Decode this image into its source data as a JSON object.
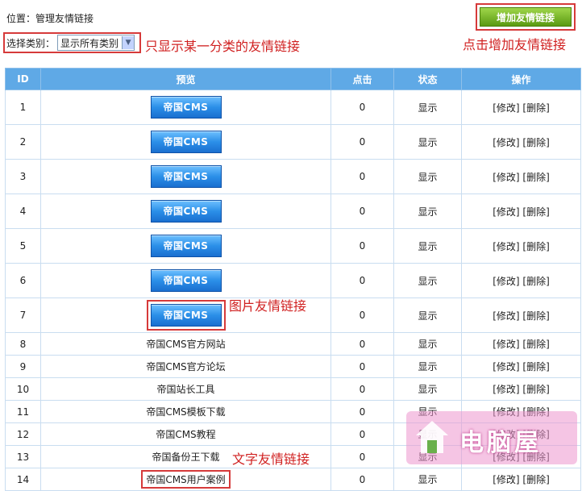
{
  "location": "位置：管理友情链接",
  "add_button": "增加友情链接",
  "notes": {
    "filter": "只显示某一分类的友情链接",
    "add": "点击增加友情链接",
    "image_link": "图片友情链接",
    "text_link": "文字友情链接"
  },
  "filter": {
    "label": "选择类别：",
    "selected": "显示所有类别"
  },
  "table": {
    "headers": [
      "ID",
      "预览",
      "点击",
      "状态",
      "操作"
    ],
    "rows": [
      {
        "id": "1",
        "preview": "帝国CMS",
        "type": "image",
        "clicks": "0",
        "status": "显示"
      },
      {
        "id": "2",
        "preview": "帝国CMS",
        "type": "image",
        "clicks": "0",
        "status": "显示"
      },
      {
        "id": "3",
        "preview": "帝国CMS",
        "type": "image",
        "clicks": "0",
        "status": "显示"
      },
      {
        "id": "4",
        "preview": "帝国CMS",
        "type": "image",
        "clicks": "0",
        "status": "显示"
      },
      {
        "id": "5",
        "preview": "帝国CMS",
        "type": "image",
        "clicks": "0",
        "status": "显示"
      },
      {
        "id": "6",
        "preview": "帝国CMS",
        "type": "image",
        "clicks": "0",
        "status": "显示"
      },
      {
        "id": "7",
        "preview": "帝国CMS",
        "type": "image",
        "clicks": "0",
        "status": "显示"
      },
      {
        "id": "8",
        "preview": "帝国CMS官方网站",
        "type": "text",
        "clicks": "0",
        "status": "显示"
      },
      {
        "id": "9",
        "preview": "帝国CMS官方论坛",
        "type": "text",
        "clicks": "0",
        "status": "显示"
      },
      {
        "id": "10",
        "preview": "帝国站长工具",
        "type": "text",
        "clicks": "0",
        "status": "显示"
      },
      {
        "id": "11",
        "preview": "帝国CMS模板下载",
        "type": "text",
        "clicks": "0",
        "status": "显示"
      },
      {
        "id": "12",
        "preview": "帝国CMS教程",
        "type": "text",
        "clicks": "0",
        "status": "显示"
      },
      {
        "id": "13",
        "preview": "帝国备份王下载",
        "type": "text",
        "clicks": "0",
        "status": "显示"
      },
      {
        "id": "14",
        "preview": "帝国CMS用户案例",
        "type": "text",
        "clicks": "0",
        "status": "显示"
      }
    ],
    "actions": {
      "edit": "[修改]",
      "delete": "[删除]"
    }
  },
  "watermark": {
    "text": "电脑屋"
  }
}
